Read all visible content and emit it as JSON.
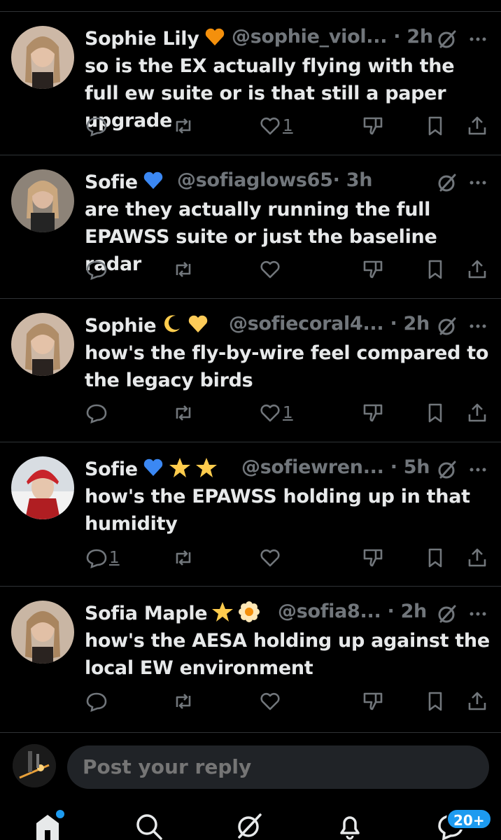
{
  "replies": [
    {
      "name": "Sophie Lily",
      "emojis": [
        "orange-heart"
      ],
      "handle": "@sophie_viol...",
      "time": "· 2h",
      "text": "so is the EX actually flying with the full ew suite or is that still a paper upgrade",
      "reply_count": "",
      "like_count": "1"
    },
    {
      "name": "Sofie",
      "emojis": [
        "blue-heart"
      ],
      "handle": "@sofiaglows65",
      "time": "· 3h",
      "text": "are they actually running the full EPAWSS suite or just the baseline radar",
      "reply_count": "",
      "like_count": ""
    },
    {
      "name": "Sophie",
      "emojis": [
        "crescent-moon",
        "yellow-heart"
      ],
      "handle": "@sofiecoral4...",
      "time": "· 2h",
      "text": "how's the fly-by-wire feel compared to the legacy birds",
      "reply_count": "",
      "like_count": "1"
    },
    {
      "name": "Sofie",
      "emojis": [
        "blue-heart",
        "star",
        "star"
      ],
      "handle": "@sofiewren...",
      "time": "· 5h",
      "text": "how's the EPAWSS holding up in that humidity",
      "reply_count": "1",
      "like_count": ""
    },
    {
      "name": "Sofia Maple",
      "emojis": [
        "star",
        "blossom"
      ],
      "handle": "@sofia8...",
      "time": "· 2h",
      "text": "how's the AESA holding up against the local EW environment",
      "reply_count": "",
      "like_count": ""
    }
  ],
  "composer": {
    "placeholder": "Post your reply"
  },
  "nav": {
    "notification_badge": "20+"
  },
  "colors": {
    "accent": "#1d9bf0",
    "muted": "#71767b",
    "text": "#e7e9ea",
    "background": "#000000",
    "divider": "#2f3336"
  }
}
